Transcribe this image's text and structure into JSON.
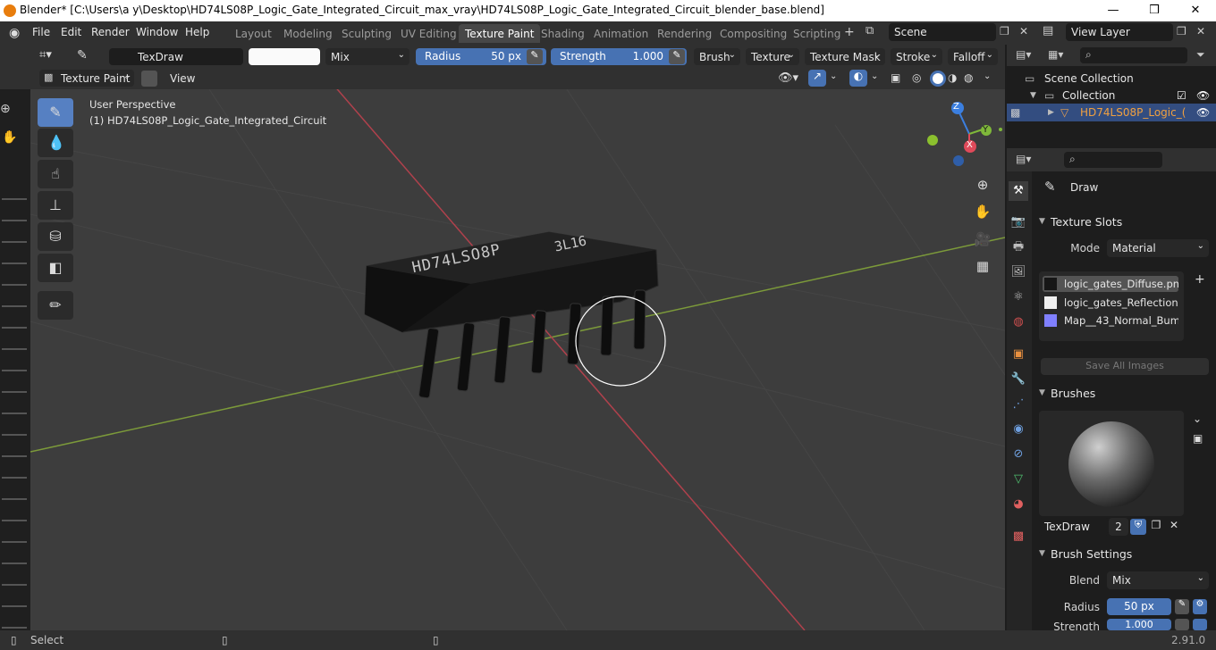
{
  "window": {
    "title": "Blender* [C:\\Users\\a y\\Desktop\\HD74LS08P_Logic_Gate_Integrated_Circuit_max_vray\\HD74LS08P_Logic_Gate_Integrated_Circuit_blender_base.blend]",
    "minimize": "—",
    "maximize": "❒",
    "close": "✕"
  },
  "menubar": {
    "items": [
      "File",
      "Edit",
      "Render",
      "Window",
      "Help"
    ]
  },
  "workspaces": [
    "Layout",
    "Modeling",
    "Sculpting",
    "UV Editing",
    "Texture Paint",
    "Shading",
    "Animation",
    "Rendering",
    "Compositing",
    "Scripting"
  ],
  "workspace_active": "Texture Paint",
  "scene": {
    "label": "Scene",
    "view_layer": "View Layer"
  },
  "tool_header": {
    "brush_name": "TexDraw",
    "blend": "Mix",
    "radius_label": "Radius",
    "radius_value": "50 px",
    "strength_label": "Strength",
    "strength_value": "1.000",
    "menus": [
      "Brush",
      "Texture",
      "Texture Mask",
      "Stroke",
      "Falloff"
    ]
  },
  "view_header": {
    "mode": "Texture Paint",
    "view": "View"
  },
  "viewport": {
    "perspective": "User Perspective",
    "object": "(1) HD74LS08P_Logic_Gate_Integrated_Circuit",
    "chip_text_1": "HD74LSO8P",
    "chip_text_2": "3L16",
    "gizmo": {
      "z": "Z",
      "y": "Y",
      "x": "X"
    }
  },
  "outliner": {
    "scene_collection": "Scene Collection",
    "collection": "Collection",
    "object": "HD74LS08P_Logic_("
  },
  "properties": {
    "tool_name": "Draw",
    "texture_slots": {
      "title": "Texture Slots",
      "mode_label": "Mode",
      "mode_value": "Material",
      "slots": [
        {
          "name": "logic_gates_Diffuse.png",
          "color": "#161616"
        },
        {
          "name": "logic_gates_Reflection...",
          "color": "#f0f0f0"
        },
        {
          "name": "Map__43_Normal_Bum...",
          "color": "#8080ff"
        }
      ],
      "save_all": "Save All Images"
    },
    "brushes": {
      "title": "Brushes",
      "name": "TexDraw",
      "users": "2"
    },
    "brush_settings": {
      "title": "Brush Settings",
      "blend_label": "Blend",
      "blend_value": "Mix",
      "radius_label": "Radius",
      "radius_value": "50 px",
      "strength_label": "Strength",
      "strength_value": "1.000"
    }
  },
  "statusbar": {
    "left": "Select",
    "version": "2.91.0"
  }
}
